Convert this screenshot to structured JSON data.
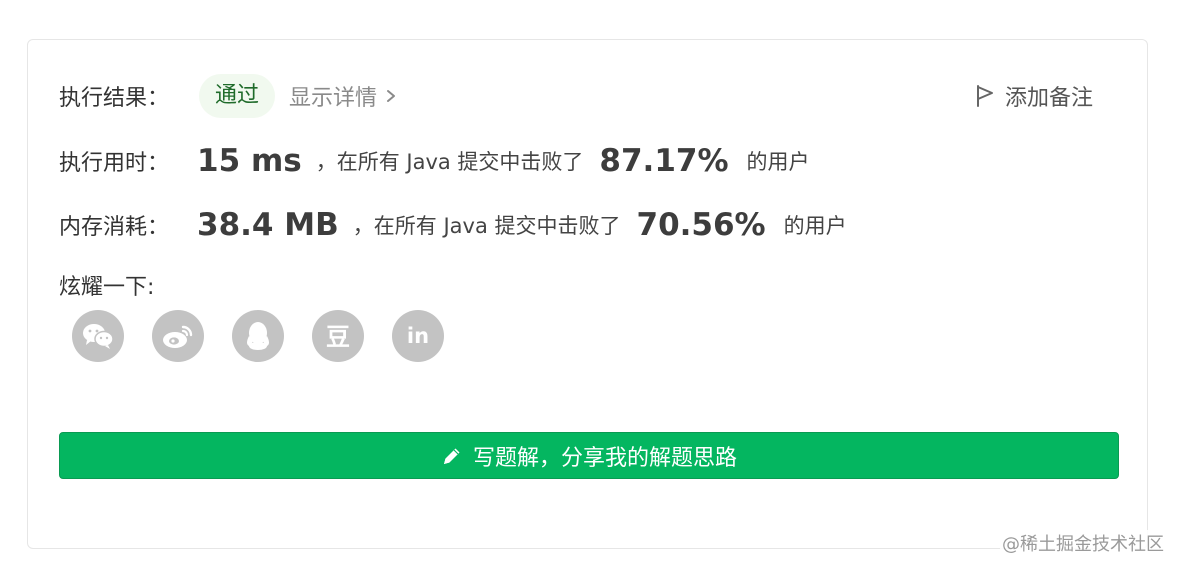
{
  "result": {
    "label": "执行结果：",
    "status": "通过",
    "details": "显示详情",
    "add_note": "添加备注"
  },
  "runtime": {
    "label": "执行用时：",
    "value": "15 ms",
    "middle": "，在所有 Java 提交中击败了",
    "percent": "87.17%",
    "tail": "的用户"
  },
  "memory": {
    "label": "内存消耗：",
    "value": "38.4 MB",
    "middle": "，在所有 Java 提交中击败了",
    "percent": "70.56%",
    "tail": "的用户"
  },
  "share": {
    "label": "炫耀一下:",
    "buttons": [
      {
        "icon": "wechat-icon"
      },
      {
        "icon": "weibo-icon"
      },
      {
        "icon": "qq-icon"
      },
      {
        "icon": "douban-icon",
        "glyph": "豆"
      },
      {
        "icon": "linkedin-icon",
        "glyph": "in"
      }
    ]
  },
  "cta": {
    "label": "写题解，分享我的解题思路",
    "icon": "pencil-icon"
  },
  "watermark": "@稀土掘金技术社区",
  "colors": {
    "primary_green": "#04b660",
    "pill_bg": "#f1f9ef",
    "icon_gray": "#c3c3c3"
  }
}
